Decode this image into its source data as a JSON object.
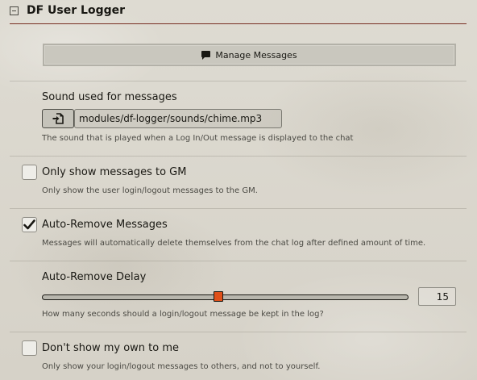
{
  "module": {
    "title": "DF User Logger"
  },
  "manage_messages": {
    "label": "Manage Messages",
    "icon": "comment-icon"
  },
  "sound": {
    "label": "Sound used for messages",
    "value": "modules/df-logger/sounds/chime.mp3",
    "hint": "The sound that is played when a Log In/Out message is displayed to the chat",
    "picker_icon": "file-import-icon"
  },
  "gm_only": {
    "label": "Only show messages to GM",
    "hint": "Only show the user login/logout messages to the GM.",
    "checked": false
  },
  "auto_remove": {
    "label": "Auto-Remove Messages",
    "hint": "Messages will automatically delete themselves from the chat log after defined amount of time.",
    "checked": true
  },
  "auto_remove_delay": {
    "label": "Auto-Remove Delay",
    "value": "15",
    "hint": "How many seconds should a login/logout message be kept in the log?"
  },
  "hide_own": {
    "label": "Don't show my own to me",
    "hint": "Only show your login/logout messages to others, and not to yourself.",
    "checked": false
  },
  "colors": {
    "accent_rule": "#782e22",
    "slider_thumb": "#e0501a",
    "text": "#191813",
    "hint_text": "#4b4a44"
  }
}
